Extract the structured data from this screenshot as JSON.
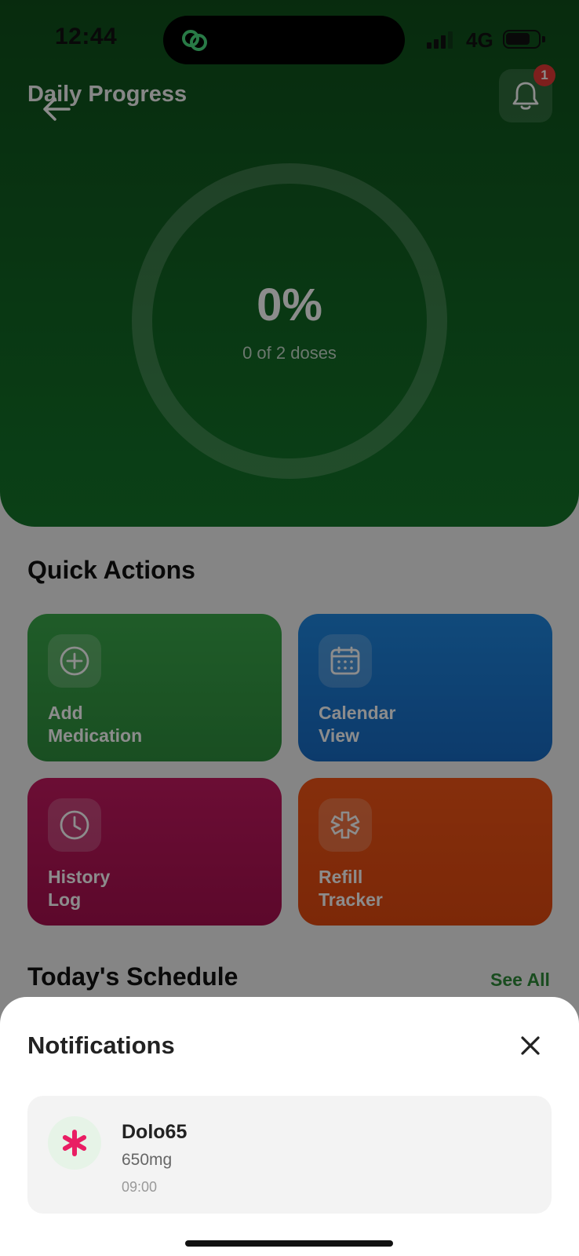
{
  "status_bar": {
    "time": "12:44",
    "network": "4G"
  },
  "header": {
    "title": "Daily Progress",
    "notification_count": "1"
  },
  "progress": {
    "percent_label": "0%",
    "doses_label": "0 of 2 doses",
    "fraction": 0
  },
  "quick_actions": {
    "title": "Quick Actions",
    "items": [
      {
        "line1": "Add",
        "line2": "Medication",
        "icon": "plus-circle-icon"
      },
      {
        "line1": "Calendar",
        "line2": "View",
        "icon": "calendar-icon"
      },
      {
        "line1": "History",
        "line2": "Log",
        "icon": "clock-icon"
      },
      {
        "line1": "Refill",
        "line2": "Tracker",
        "icon": "medical-star-icon"
      }
    ]
  },
  "schedule": {
    "title": "Today's Schedule",
    "see_all": "See All"
  },
  "notifications_sheet": {
    "title": "Notifications",
    "items": [
      {
        "name": "Dolo65",
        "dose": "650mg",
        "time": "09:00",
        "icon_color": "#e91e63"
      }
    ]
  },
  "colors": {
    "hero_green": "#14762a",
    "accent_green": "#2e8b3a",
    "badge_red": "#e53935"
  }
}
